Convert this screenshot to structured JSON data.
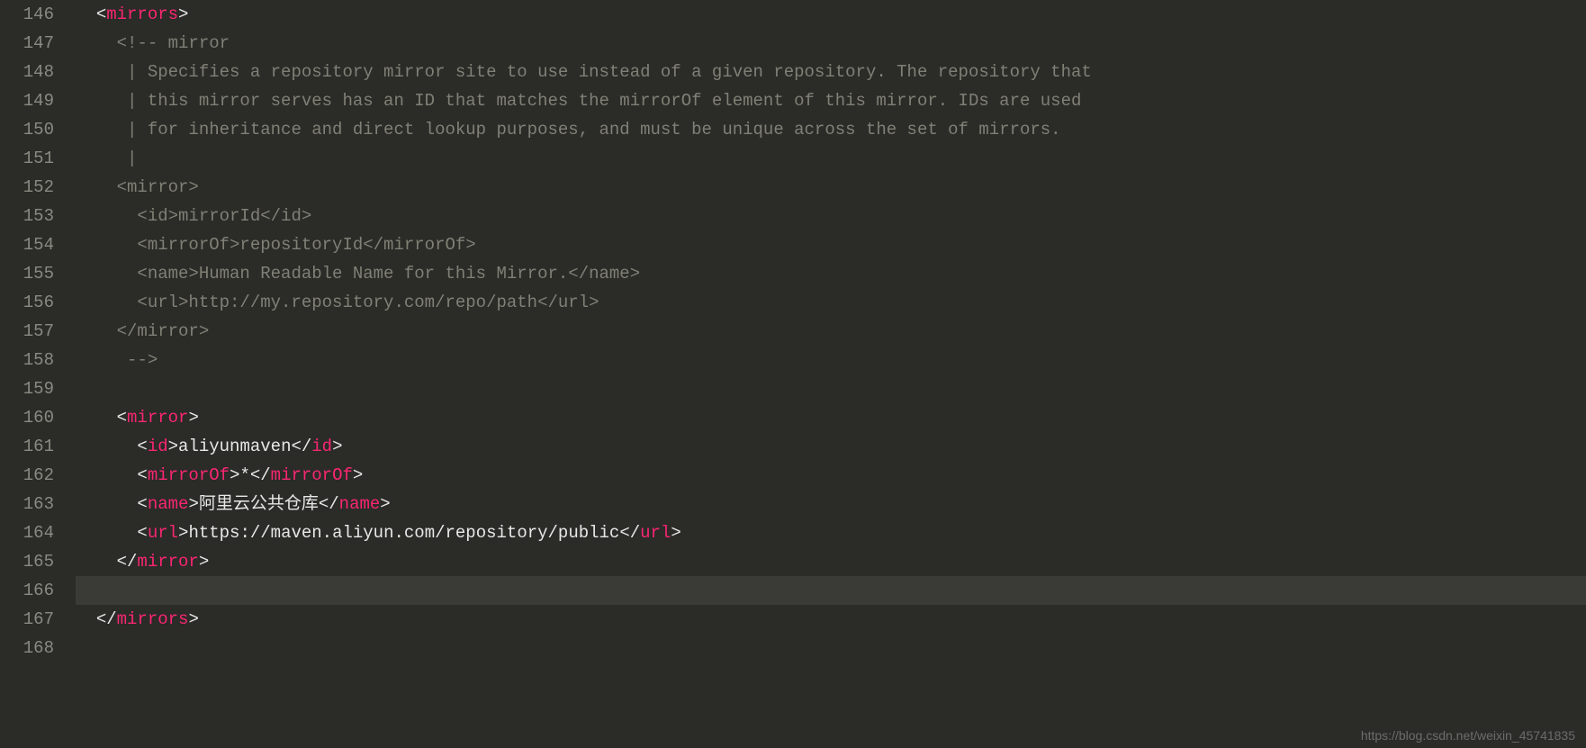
{
  "watermark": "https://blog.csdn.net/weixin_45741835",
  "lineNumbers": [
    "146",
    "147",
    "148",
    "149",
    "150",
    "151",
    "152",
    "153",
    "154",
    "155",
    "156",
    "157",
    "158",
    "159",
    "160",
    "161",
    "162",
    "163",
    "164",
    "165",
    "166",
    "167",
    "168"
  ],
  "code": {
    "l146": {
      "tag": "mirrors"
    },
    "l147": {
      "comment_start": "<!-- mirror"
    },
    "l148": {
      "c": " | Specifies a repository mirror site to use instead of a given repository. The repository that"
    },
    "l149": {
      "c": " | this mirror serves has an ID that matches the mirrorOf element of this mirror. IDs are used"
    },
    "l150": {
      "c": " | for inheritance and direct lookup purposes, and must be unique across the set of mirrors."
    },
    "l151": {
      "c": " |"
    },
    "l152": {
      "c": "<mirror>"
    },
    "l153": {
      "c": "  <id>mirrorId</id>"
    },
    "l154": {
      "c": "  <mirrorOf>repositoryId</mirrorOf>"
    },
    "l155": {
      "c": "  <name>Human Readable Name for this Mirror.</name>"
    },
    "l156": {
      "c": "  <url>http://my.repository.com/repo/path</url>"
    },
    "l157": {
      "c": "</mirror>"
    },
    "l158": {
      "c": " -->"
    },
    "l160": {
      "tag": "mirror"
    },
    "l161": {
      "tag": "id",
      "text": "aliyunmaven"
    },
    "l162": {
      "tag": "mirrorOf",
      "text": "*"
    },
    "l163": {
      "tag": "name",
      "text": "阿里云公共仓库"
    },
    "l164": {
      "tag": "url",
      "text": "https://maven.aliyun.com/repository/public"
    },
    "l165": {
      "tag": "mirror"
    },
    "l167": {
      "tag": "mirrors"
    }
  }
}
